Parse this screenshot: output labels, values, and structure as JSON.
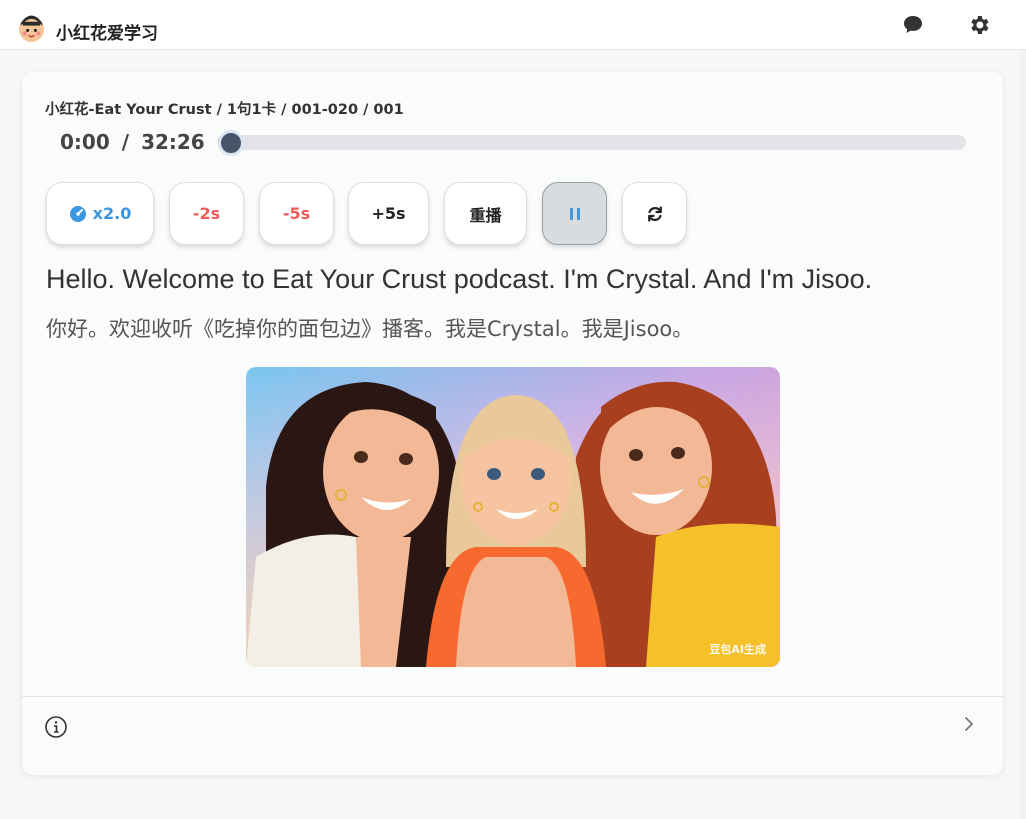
{
  "app": {
    "title": "小红花爱学习"
  },
  "breadcrumb": "小红花-Eat Your Crust / 1句1卡 / 001-020 / 001",
  "player": {
    "current_time": "0:00",
    "separator": "/",
    "total_time": "32:26",
    "progress_fraction": 0.018
  },
  "controls": {
    "speed_label": "x2.0",
    "back2_label": "-2s",
    "back5_label": "-5s",
    "fwd5_label": "+5s",
    "replay_label": "重播"
  },
  "sentence": {
    "english": "Hello. Welcome to Eat Your Crust podcast. I'm Crystal. And I'm Jisoo.",
    "chinese": "你好。欢迎收听《吃掉你的面包边》播客。我是Crystal。我是Jisoo。"
  },
  "illustration": {
    "watermark": "豆包AI生成"
  },
  "colors": {
    "accent": "#3a97e0",
    "danger": "#f05a5a",
    "progress": "#4a5468"
  },
  "icons": [
    "logo-icon",
    "chat-icon",
    "gear-icon",
    "speed-icon",
    "pause-icon",
    "loop-icon",
    "info-icon",
    "chevron-right-icon"
  ]
}
